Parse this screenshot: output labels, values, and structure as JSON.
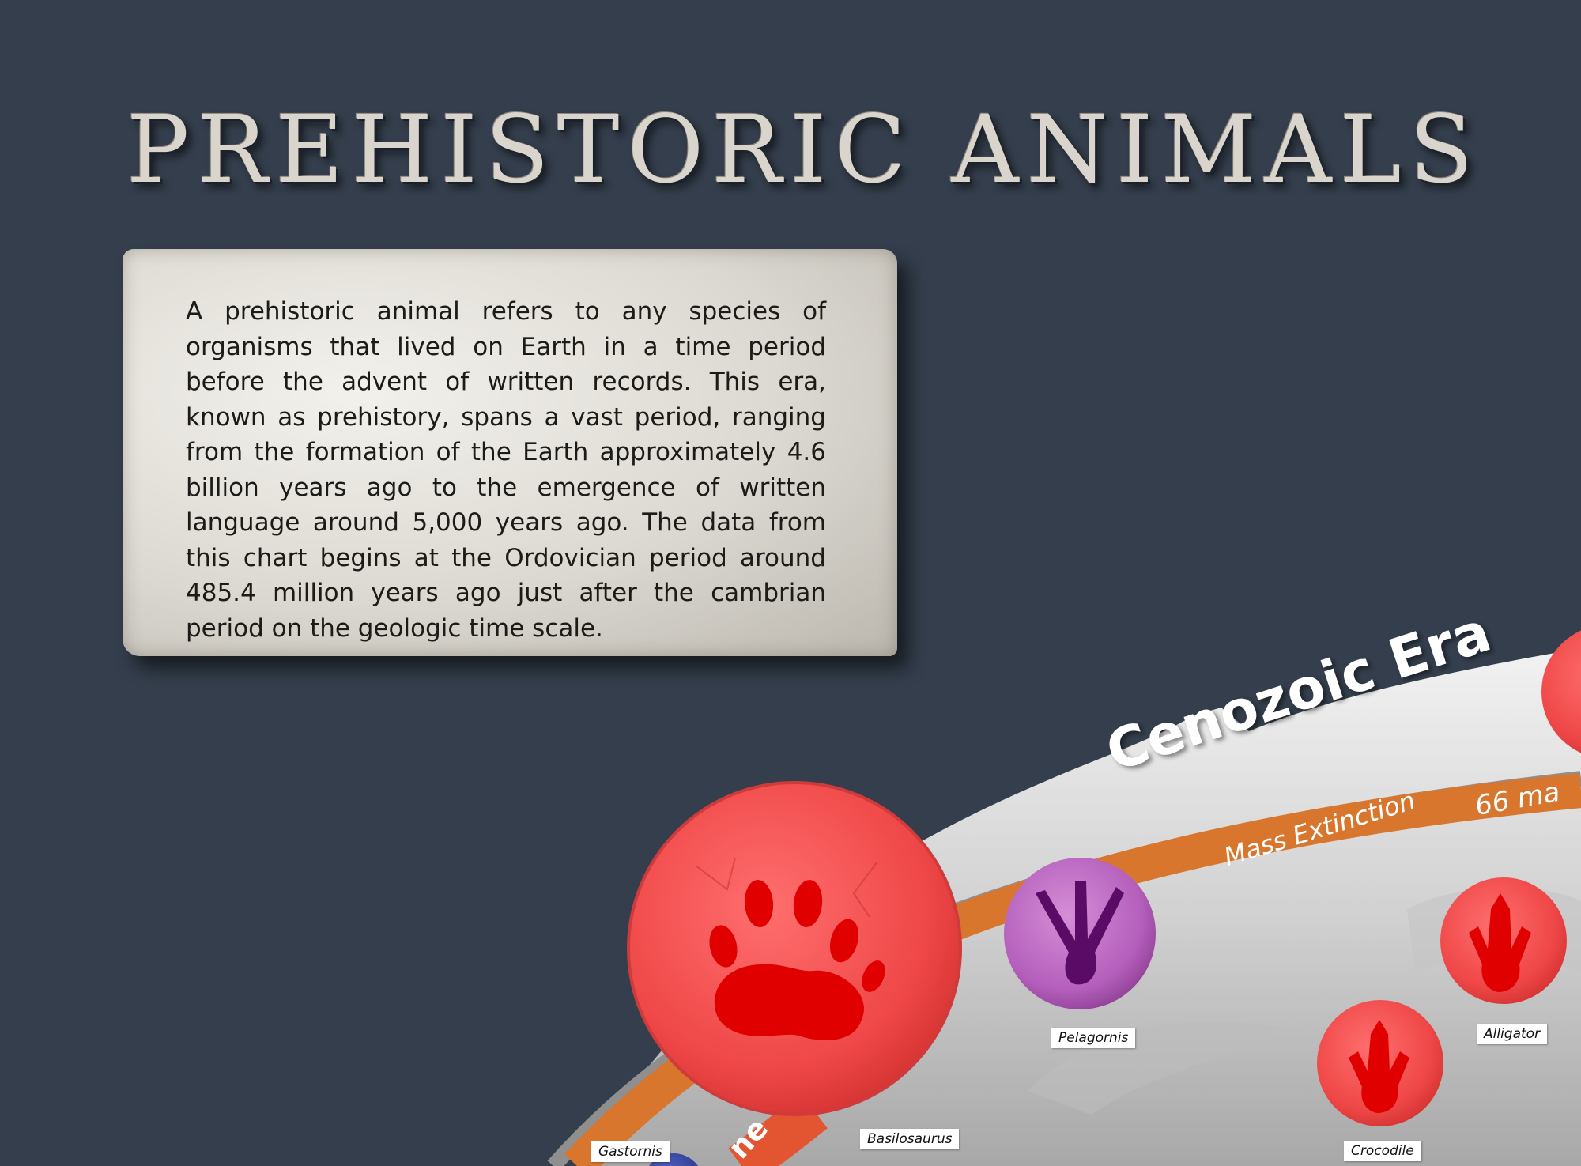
{
  "title": "PREHISTORIC ANIMALS",
  "intro": "A prehistoric animal refers to any species of organisms that lived on Earth in a time period before the advent of written records. This era, known as prehistory, spans a vast period, ranging from the formation of the Earth approximately 4.6 billion years ago to the emergence of written language around 5,000 years ago.  The data from this chart begins at the Ordovician period around 485.4 million years ago just after the cambrian period on the geologic time scale.",
  "timeline": {
    "era": "Cenozoic Era",
    "event": "Mass Extinction",
    "event_time": "66 ma",
    "band_partial": "ne"
  },
  "animals": [
    {
      "name": "Gastornis",
      "icon": "bird-footprint-icon",
      "color": "#3a49a8"
    },
    {
      "name": "Basilosaurus",
      "icon": "paw-print-icon",
      "color": "#f24b4b"
    },
    {
      "name": "Pelagornis",
      "icon": "bird-footprint-icon",
      "color": "#a955b5"
    },
    {
      "name": "Alligator",
      "icon": "reptile-footprint-icon",
      "color": "#f24b4b"
    },
    {
      "name": "Crocodile",
      "icon": "reptile-footprint-icon",
      "color": "#f24b4b"
    }
  ],
  "colors": {
    "background": "#343e4c",
    "timeline_band": "#d8762e",
    "mammal": "#f24b4b",
    "bird": "#a955b5"
  }
}
